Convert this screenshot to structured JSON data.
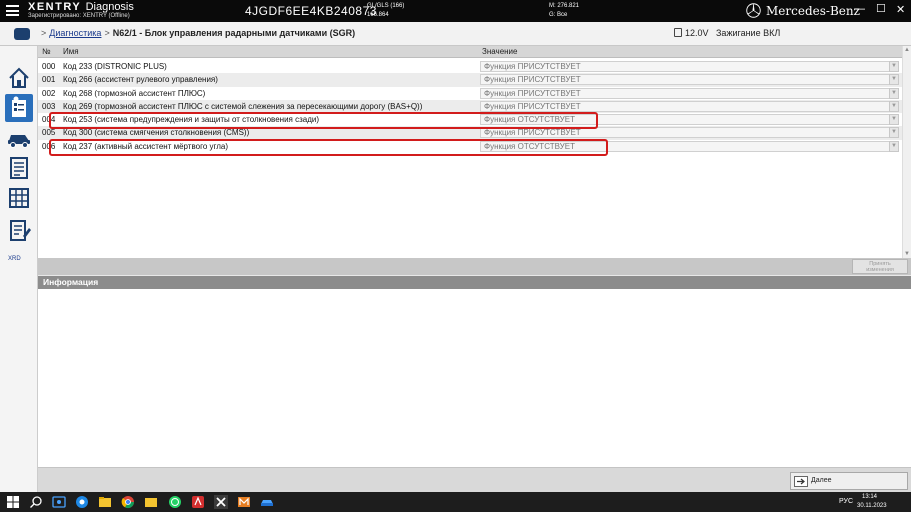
{
  "header": {
    "logo": "XENTRY",
    "logo_suffix": "Diagnosis",
    "registered": "Зарегистрировано: XENTRY (Offline)",
    "vin": "4JGDF6EE4KB240873",
    "model_line1": "GL/GLS (166)",
    "model_line2": "166.864",
    "version_line1": "M: 276.821",
    "version_line2": "G: Все",
    "brand": "Mercedes-Benz"
  },
  "breadcrumb": {
    "root": "Диагностика",
    "separator": ">",
    "current": "N62/1 - Блок управления радарными датчиками (SGR)"
  },
  "status": {
    "battery_voltage": "12.0V",
    "ignition": "Зажигание ВКЛ"
  },
  "sidebar": {
    "xrd_label": "XRD"
  },
  "table": {
    "col_no": "№",
    "col_name": "Имя",
    "col_value": "Значение",
    "rows": [
      {
        "no": "000",
        "name": "Код 233 (DISTRONIC PLUS)",
        "value": "Функция ПРИСУТСТВУЕТ"
      },
      {
        "no": "001",
        "name": "Код 266 (ассистент рулевого управления)",
        "value": "Функция ПРИСУТСТВУЕТ"
      },
      {
        "no": "002",
        "name": "Код 268 (тормозной ассистент ПЛЮС)",
        "value": "Функция ПРИСУТСТВУЕТ"
      },
      {
        "no": "003",
        "name": "Код 269 (тормозной ассистент ПЛЮС с системой слежения за пересекающими дорогу (BAS+Q))",
        "value": "Функция ПРИСУТСТВУЕТ"
      },
      {
        "no": "004",
        "name": "Код 253 (система предупреждения и защиты от столкновения сзади)",
        "value": "Функция ОТСУТСТВУЕТ"
      },
      {
        "no": "005",
        "name": "Код 300 (система смягчения столкновения (CMS))",
        "value": "Функция ПРИСУТСТВУЕТ"
      },
      {
        "no": "006",
        "name": "Код 237 (активный ассистент мёртвого угла)",
        "value": "Функция ОТСУТСТВУЕТ"
      }
    ]
  },
  "apply_button": {
    "line1": "Принять",
    "line2": "изменения"
  },
  "info": {
    "title": "Информация"
  },
  "next_button": {
    "label": "Далее"
  },
  "taskbar": {
    "lang": "РУС",
    "time": "13:14",
    "date": "30.11.2023"
  },
  "colors": {
    "header_bg": "#0a0a0a",
    "accent": "#2a6fbb",
    "highlight": "#d21c1c"
  }
}
